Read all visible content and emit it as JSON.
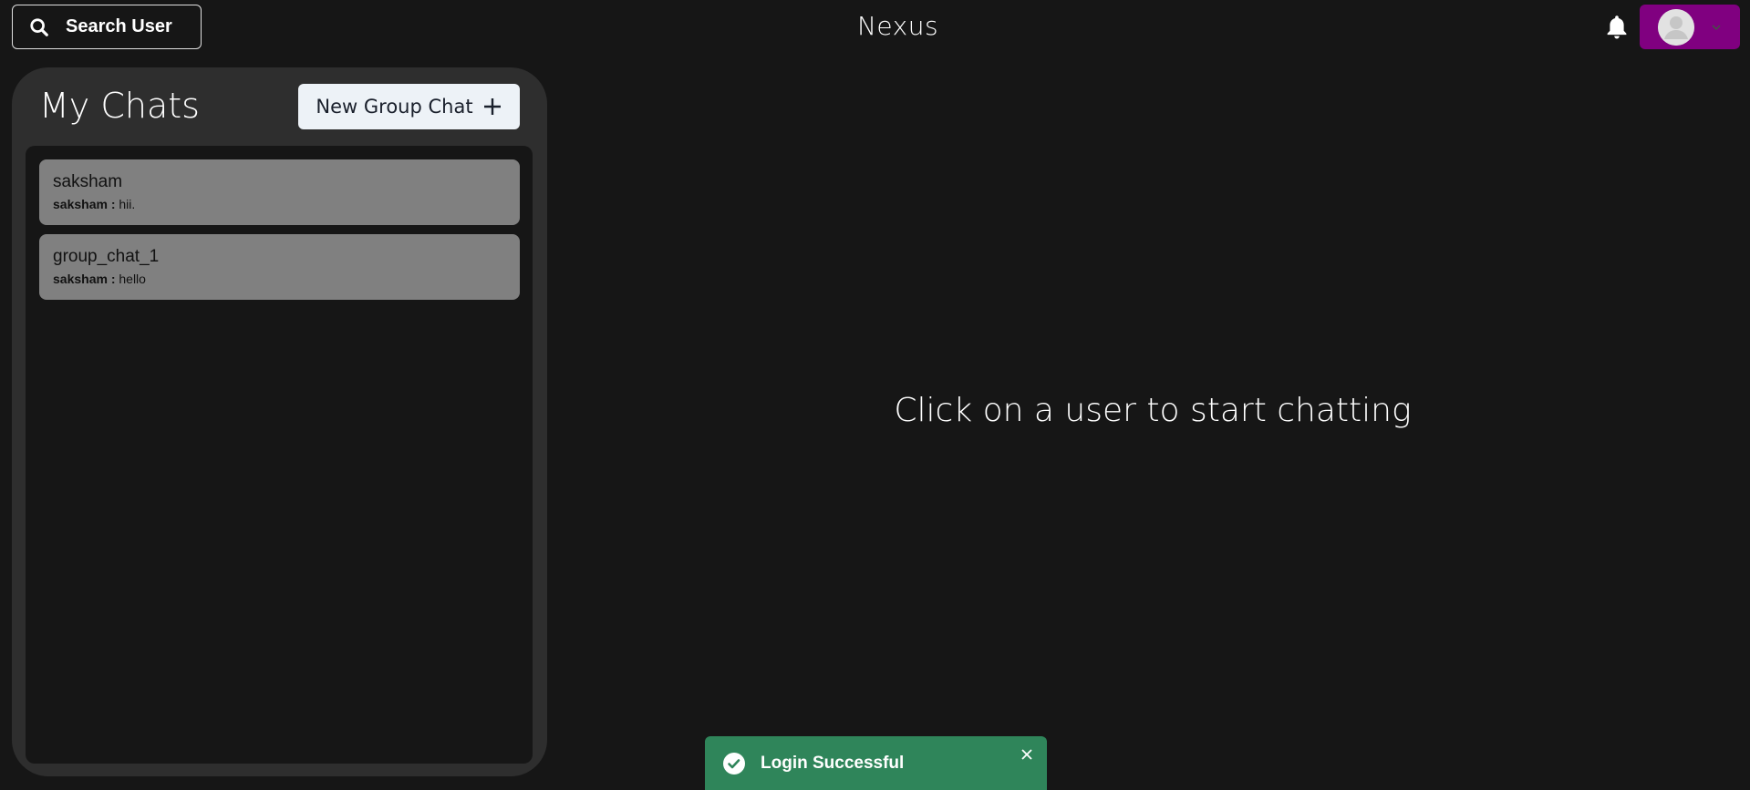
{
  "header": {
    "search_label": "Search User",
    "app_title": "Nexus",
    "notification_icon": "bell-icon",
    "profile_icon": "user-avatar-icon",
    "profile_color": "#800080"
  },
  "sidebar": {
    "title": "My Chats",
    "new_group_label": "New Group Chat",
    "chats": [
      {
        "name": "saksham",
        "sender": "saksham :",
        "message": "hii."
      },
      {
        "name": "group_chat_1",
        "sender": "saksham :",
        "message": "hello"
      }
    ]
  },
  "main": {
    "empty_message": "Click on a user to start chatting"
  },
  "toast": {
    "message": "Login Successful",
    "status_color": "#2f855a"
  }
}
